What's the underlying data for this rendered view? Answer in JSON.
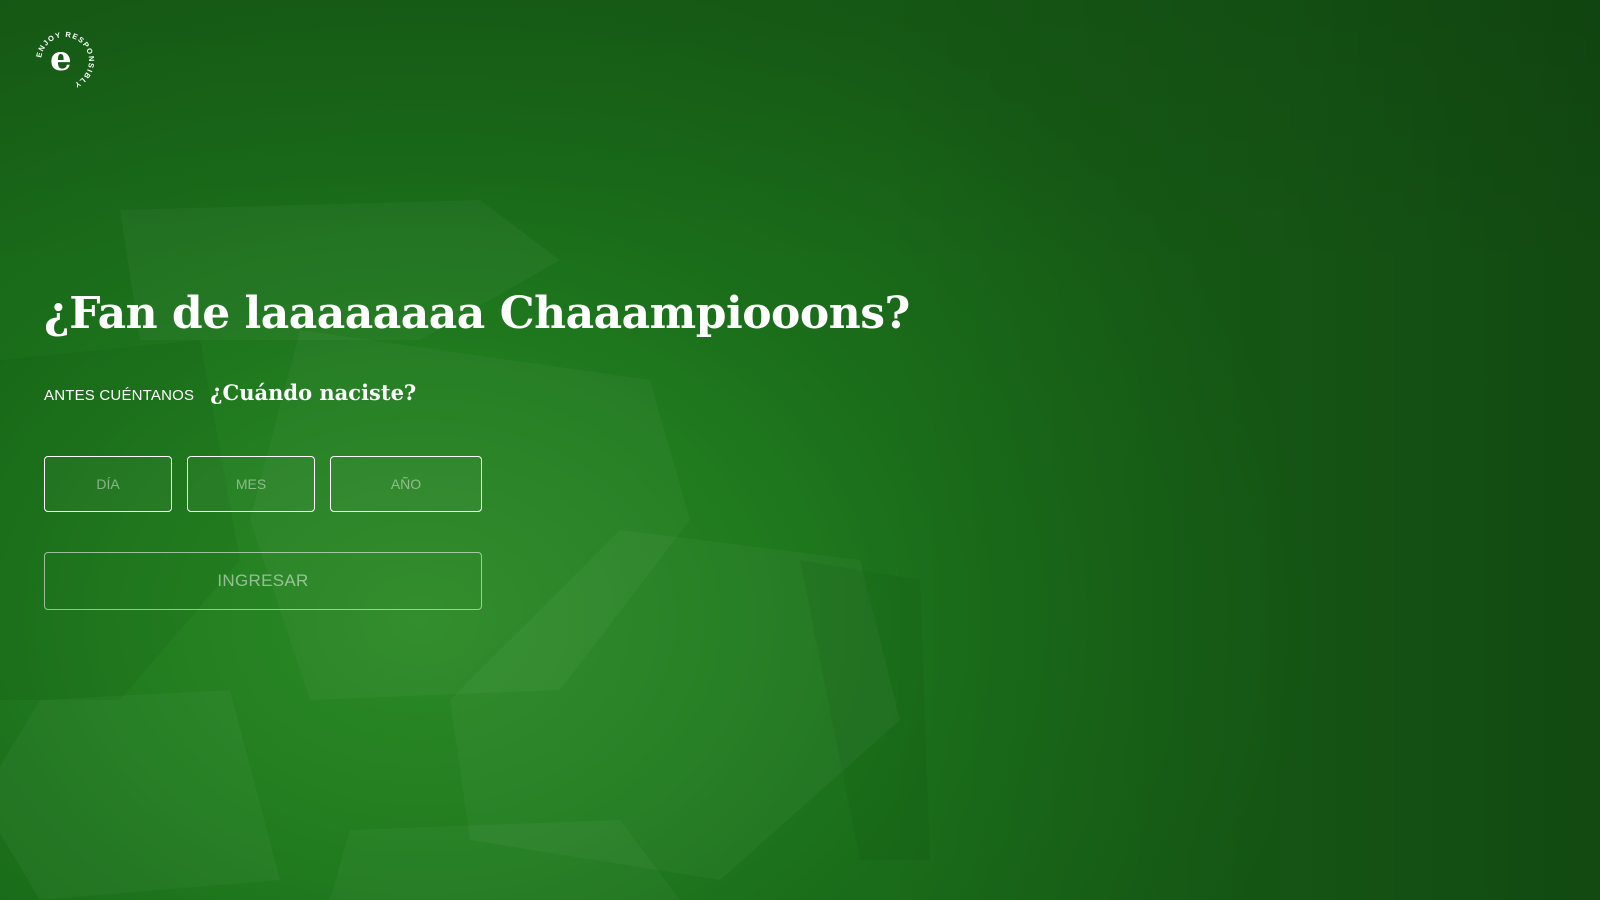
{
  "brand": {
    "logo_letter": "e",
    "logo_text": "ENJOY RESPONSIBLY"
  },
  "hero": {
    "headline": "¿Fan de laaaaaaaa Chaaampiooons?",
    "sub_label": "ANTES CUÉNTANOS",
    "sub_question": "¿Cuándo naciste?"
  },
  "form": {
    "day_placeholder": "DÍA",
    "month_placeholder": "MES",
    "year_placeholder": "AÑO",
    "submit_label": "INGRESAR"
  },
  "colors": {
    "background": "#217c1f",
    "background_dark": "#175e16",
    "text": "#ffffff"
  }
}
